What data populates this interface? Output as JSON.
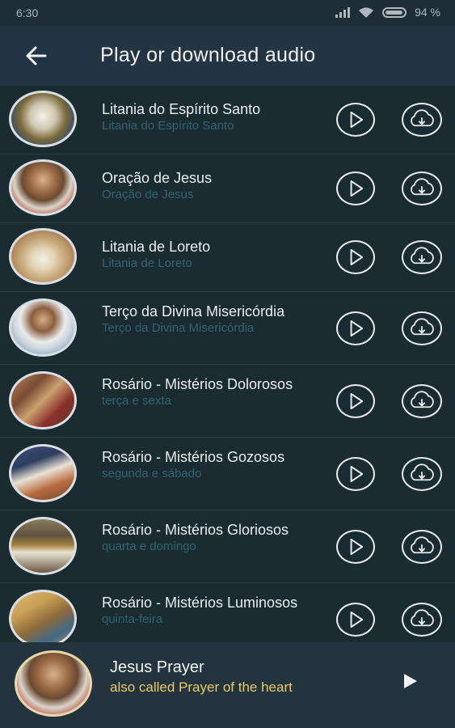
{
  "status": {
    "time": "6:30",
    "battery": "94 %"
  },
  "header": {
    "title": "Play or download audio"
  },
  "items": [
    {
      "title": "Litania do Espírito Santo",
      "subtitle": "Litania do Espírito Santo"
    },
    {
      "title": "Oração de Jesus",
      "subtitle": "Oração de Jesus"
    },
    {
      "title": "Litania de Loreto",
      "subtitle": "Litania de Loreto"
    },
    {
      "title": "Terço da Divina Misericórdia",
      "subtitle": "Terço da Divina Misericórdia"
    },
    {
      "title": "Rosário - Mistérios Dolorosos",
      "subtitle": "terça e sexta"
    },
    {
      "title": "Rosário - Mistérios Gozosos",
      "subtitle": "segunda e sábado"
    },
    {
      "title": "Rosário - Mistérios Gloriosos",
      "subtitle": "quarta e domingo"
    },
    {
      "title": "Rosário - Mistérios Luminosos",
      "subtitle": "quinta-feira"
    }
  ],
  "player": {
    "title": "Jesus Prayer",
    "subtitle": "also called Prayer of the heart"
  },
  "colors": {
    "accent": "#e8c968",
    "background": "#1d2a33"
  }
}
